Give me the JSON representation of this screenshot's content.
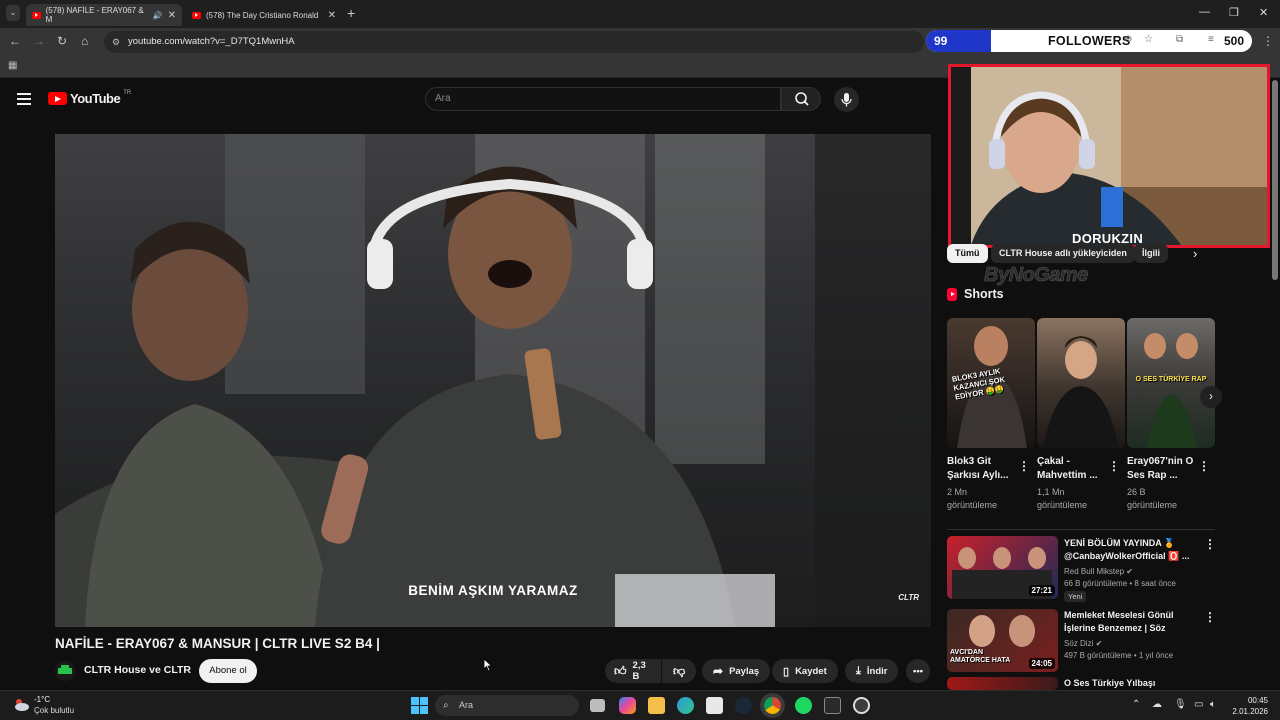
{
  "browser": {
    "tabs": [
      {
        "label": "(578) NAFİLE - ERAY067 & M",
        "active": true
      },
      {
        "label": "(578) The Day Cristiano Ronaldo",
        "active": false
      }
    ],
    "new_tab": "+",
    "url": "youtube.com/watch?v=_D7TQ1MwnHA"
  },
  "followers_overlay": {
    "current": "99",
    "label": "FOLLOWERS",
    "goal": "500",
    "progress_fraction": 0.198
  },
  "youtube": {
    "logo_text": "YouTube",
    "country_code": "TR",
    "search_placeholder": "Ara"
  },
  "video": {
    "subtitle": "BENİM AŞKIM YARAMAZ",
    "watermark": "CLTR",
    "title": "NAFİLE - ERAY067 & MANSUR | CLTR LIVE S2 B4 |",
    "channel": "CLTR House ve CLTR",
    "subscribe_label": "Abone ol",
    "like_count": "2,3 B",
    "share_label": "Paylaş",
    "save_label": "Kaydet",
    "download_label": "İndir"
  },
  "webcam": {
    "streamer_name": "DORUKZIN",
    "brand_watermark": "ByNoGame"
  },
  "sidebar": {
    "chips": [
      "Tümü",
      "CLTR House adlı yükleyiciden",
      "İlgili"
    ],
    "shorts_heading": "Shorts",
    "shorts": [
      {
        "title": "Blok3 Git Şarkısı Aylı...",
        "views_line1": "2 Mn",
        "views_line2": "görüntüleme",
        "thumb_text": "BLOK3 AYLIK KAZANCI ŞOK EDİYOR 🤑🤑"
      },
      {
        "title": "Çakal - Mahvettim ...",
        "views_line1": "1,1 Mn",
        "views_line2": "görüntüleme",
        "thumb_text": ""
      },
      {
        "title": "Eray067'nin O Ses Rap ...",
        "views_line1": "26 B",
        "views_line2": "görüntüleme",
        "thumb_text": "O SES TÜRKİYE RAP"
      }
    ],
    "recommended": [
      {
        "title": "YENİ BÖLÜM YAYINDA 🏅 @CanbayWolkerOfficial 🅾️ ...",
        "channel": "Red Bull Mikstep",
        "meta": "66 B görüntüleme • 8 saat önce",
        "badge": "Yeni",
        "duration": "27:21"
      },
      {
        "title": "Memleket Meselesi Gönül İşlerine Benzemez | Söz",
        "channel": "Söz Dizi",
        "meta": "497 B görüntüleme • 1 yıl önce",
        "badge": "",
        "duration": "24:05",
        "thumb_text": "AVCI'DAN AMATÖRCE HATA"
      },
      {
        "title": "O Ses Türkiye Yılbaşı",
        "channel": "",
        "meta": "",
        "badge": "",
        "duration": ""
      }
    ]
  },
  "taskbar": {
    "temperature": "-1°C",
    "condition": "Çok bulutlu",
    "search_placeholder": "Ara",
    "time": "00:45",
    "date": "2.01.2026"
  },
  "colors": {
    "accent_red": "#ff0000",
    "webcam_border": "#e5162d",
    "followers_fill": "#1f36c9"
  }
}
